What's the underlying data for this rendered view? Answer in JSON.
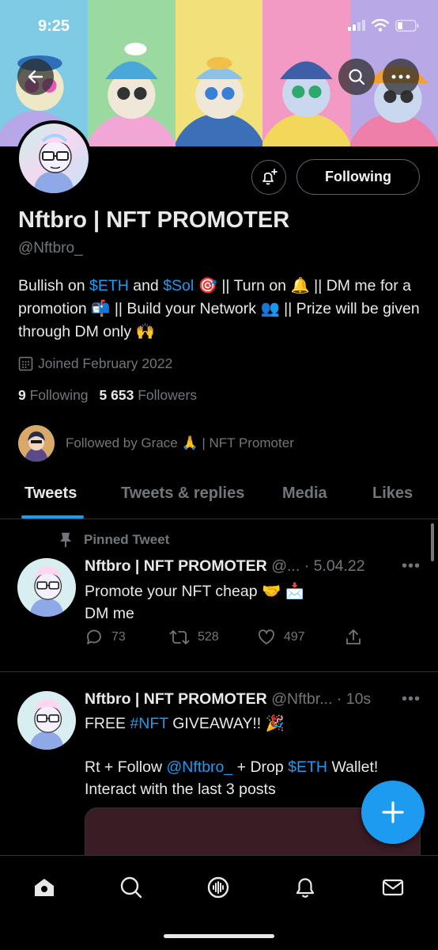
{
  "status_bar": {
    "time": "9:25"
  },
  "profile": {
    "display_name": "Nftbro | NFT PROMOTER",
    "handle": "@Nftbro_",
    "following_button": "Following",
    "bio": {
      "part1": "Bullish on ",
      "eth": "$ETH",
      "and": " and ",
      "sol": "$Sol",
      "part2": " 🎯 || Turn on 🔔 || DM me for a promotion 📬 || Build your Network 👥 || Prize will be given through DM only 🙌"
    },
    "joined": "Joined February 2022",
    "following_count": "9",
    "following_label": "Following",
    "followers_count": "5 653",
    "followers_label": "Followers",
    "followed_by": "Followed by Grace 🙏 | NFT Promoter"
  },
  "tabs": [
    {
      "label": "Tweets",
      "active": true
    },
    {
      "label": "Tweets & replies",
      "active": false
    },
    {
      "label": "Media",
      "active": false
    },
    {
      "label": "Likes",
      "active": false
    }
  ],
  "tweets": [
    {
      "pinned_label": "Pinned Tweet",
      "name": "Nftbro | NFT PROMOTER",
      "meta": "@... · 5.04.22",
      "line1": "Promote your NFT cheap 🤝 📩",
      "line2": "DM me",
      "replies": "73",
      "retweets": "528",
      "likes": "497"
    },
    {
      "name": "Nftbro | NFT PROMOTER",
      "meta": "@Nftbr... · 10s",
      "line1_a": "FREE ",
      "line1_tag": "#NFT",
      "line1_b": " GIVEAWAY!! 🎉",
      "line2_a": "Rt + Follow ",
      "line2_mention": "@Nftbro_",
      "line2_b": "  + Drop ",
      "line2_eth": "$ETH",
      "line2_c": " Wallet!",
      "line3": "Interact with the last 3 posts"
    }
  ],
  "colors": {
    "accent": "#1d9bf0",
    "background": "#000000",
    "muted": "#71767b",
    "text": "#e7e9ea"
  },
  "icons": [
    "back-arrow-icon",
    "search-icon",
    "more-icon",
    "bell-plus-icon",
    "calendar-icon",
    "pin-icon",
    "reply-icon",
    "retweet-icon",
    "like-icon",
    "share-icon",
    "compose-plus-icon",
    "home-icon",
    "explore-icon",
    "spaces-icon",
    "notifications-icon",
    "messages-icon"
  ]
}
